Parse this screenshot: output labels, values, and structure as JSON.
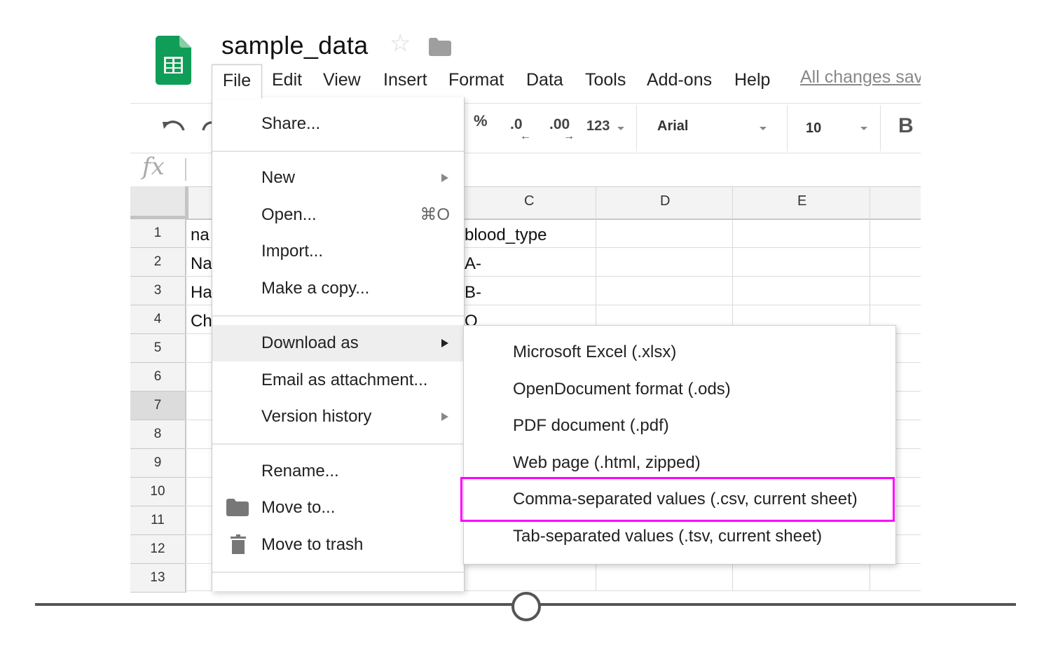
{
  "app": {
    "doc_title": "sample_data",
    "saved_status": "All changes saved in Drive"
  },
  "menubar": {
    "items": [
      "File",
      "Edit",
      "View",
      "Insert",
      "Format",
      "Data",
      "Tools",
      "Add-ons",
      "Help"
    ]
  },
  "toolbar": {
    "percent": "%",
    "decrease_decimal": ".0",
    "increase_decimal": ".00",
    "more_formats": "123",
    "font": "Arial",
    "font_size": "10",
    "bold": "B"
  },
  "formula_bar": {
    "fx": "fx"
  },
  "grid": {
    "columns": [
      "C",
      "D",
      "E"
    ],
    "rows": [
      "1",
      "2",
      "3",
      "4",
      "5",
      "6",
      "7",
      "8",
      "9",
      "10",
      "11",
      "12",
      "13"
    ],
    "selected_row": "7",
    "col_a_cells": [
      "na",
      "Na",
      "Ha",
      "Ch"
    ],
    "col_c_cells": [
      "blood_type",
      "A-",
      "B-",
      "O"
    ]
  },
  "file_menu": {
    "share": "Share...",
    "new": "New",
    "open": "Open...",
    "open_shortcut": "⌘O",
    "import": "Import...",
    "make_copy": "Make a copy...",
    "download_as": "Download as",
    "email_attachment": "Email as attachment...",
    "version_history": "Version history",
    "rename": "Rename...",
    "move_to": "Move to...",
    "move_to_trash": "Move to trash"
  },
  "download_submenu": {
    "items": [
      "Microsoft Excel (.xlsx)",
      "OpenDocument format (.ods)",
      "PDF document (.pdf)",
      "Web page (.html, zipped)",
      "Comma-separated values (.csv, current sheet)",
      "Tab-separated values (.tsv, current sheet)"
    ],
    "highlighted_index": 4
  },
  "colors": {
    "highlight": "#ff00ff",
    "sheets_green": "#0f9d58"
  }
}
